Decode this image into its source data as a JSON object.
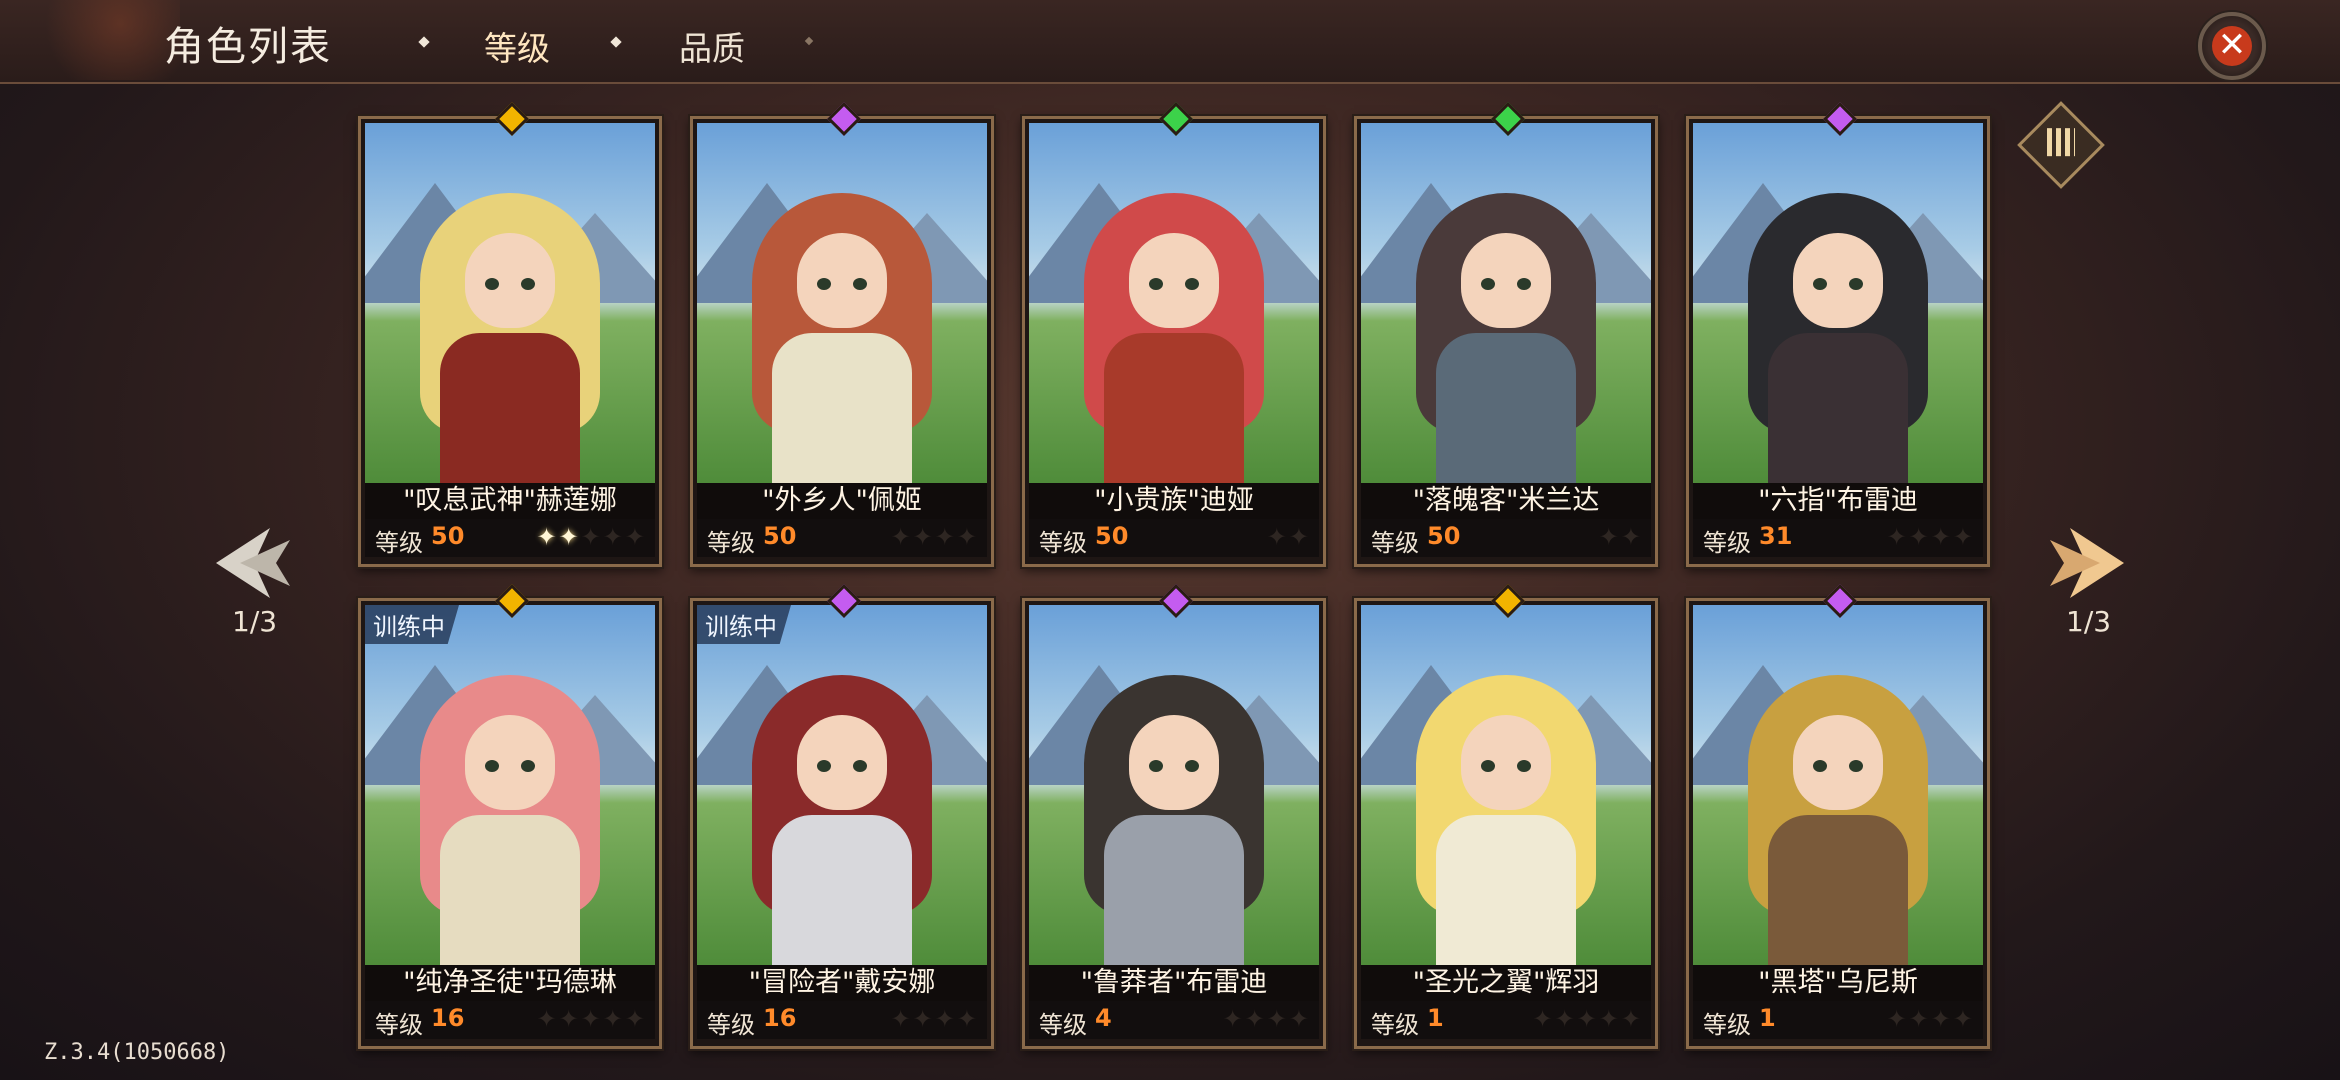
{
  "header": {
    "title": "角色列表",
    "tabs": [
      {
        "label": "等级",
        "active": true
      },
      {
        "label": "品质",
        "active": false
      }
    ]
  },
  "pager": {
    "left": "1/3",
    "right": "1/3"
  },
  "version": "Z.3.4(1050668)",
  "colors": {
    "gem_gold": "#f2b400",
    "gem_purple": "#c45cf0",
    "gem_green": "#3cd24a",
    "level_value": "#ff8a2a",
    "close": "#c83a1c"
  },
  "heroes": [
    {
      "name": "\"叹息武神\"赫莲娜",
      "level_label": "等级",
      "level": "50",
      "stars": "✦✦✦✦✦",
      "stars_on": 2,
      "gem": "gold",
      "training": "",
      "hair": "#e8d27a",
      "outfit": "#8a2a22"
    },
    {
      "name": "\"外乡人\"佩姬",
      "level_label": "等级",
      "level": "50",
      "stars": "✦✦✦✦",
      "stars_on": 0,
      "gem": "purple",
      "training": "",
      "hair": "#b8583a",
      "outfit": "#e8e2c8"
    },
    {
      "name": "\"小贵族\"迪娅",
      "level_label": "等级",
      "level": "50",
      "stars": "✦✦",
      "stars_on": 0,
      "gem": "green",
      "training": "",
      "hair": "#d04a4a",
      "outfit": "#a83a2a"
    },
    {
      "name": "\"落魄客\"米兰达",
      "level_label": "等级",
      "level": "50",
      "stars": "✦✦",
      "stars_on": 0,
      "gem": "green",
      "training": "",
      "hair": "#4a3a3a",
      "outfit": "#5a6a78"
    },
    {
      "name": "\"六指\"布雷迪",
      "level_label": "等级",
      "level": "31",
      "stars": "✦✦✦✦",
      "stars_on": 0,
      "gem": "purple",
      "training": "",
      "hair": "#2a2a2e",
      "outfit": "#3a3034"
    },
    {
      "name": "\"纯净圣徒\"玛德琳",
      "level_label": "等级",
      "level": "16",
      "stars": "✦✦✦✦✦",
      "stars_on": 0,
      "gem": "gold",
      "training": "训练中",
      "hair": "#e88a8a",
      "outfit": "#e6dcc0"
    },
    {
      "name": "\"冒险者\"戴安娜",
      "level_label": "等级",
      "level": "16",
      "stars": "✦✦✦✦",
      "stars_on": 0,
      "gem": "purple",
      "training": "训练中",
      "hair": "#8a2a2a",
      "outfit": "#d8d8dc"
    },
    {
      "name": "\"鲁莽者\"布雷迪",
      "level_label": "等级",
      "level": "4",
      "stars": "✦✦✦✦",
      "stars_on": 0,
      "gem": "purple",
      "training": "",
      "hair": "#3a3430",
      "outfit": "#9aa0aa"
    },
    {
      "name": "\"圣光之翼\"辉羽",
      "level_label": "等级",
      "level": "1",
      "stars": "✦✦✦✦✦",
      "stars_on": 0,
      "gem": "gold",
      "training": "",
      "hair": "#f2d870",
      "outfit": "#f0ead4"
    },
    {
      "name": "\"黑塔\"乌尼斯",
      "level_label": "等级",
      "level": "1",
      "stars": "✦✦✦✦",
      "stars_on": 0,
      "gem": "purple",
      "training": "",
      "hair": "#c8a040",
      "outfit": "#7a5a3a"
    }
  ]
}
